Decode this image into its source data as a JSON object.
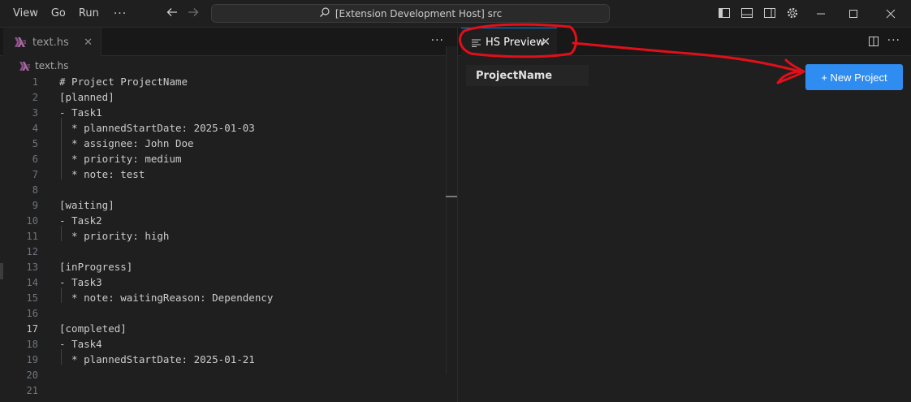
{
  "menu": {
    "items": [
      "View",
      "Go",
      "Run"
    ],
    "more": "···"
  },
  "command_center": {
    "text": "[Extension Development Host] src"
  },
  "left_editor": {
    "tab": {
      "label": "text.hs",
      "close": "✕"
    },
    "more": "···",
    "breadcrumb": "text.hs",
    "active_line": 17,
    "lines": [
      {
        "n": "1",
        "text": "# Project ProjectName",
        "guide": false
      },
      {
        "n": "2",
        "text": "[planned]",
        "guide": false
      },
      {
        "n": "3",
        "text": "- Task1",
        "guide": false
      },
      {
        "n": "4",
        "text": "  * plannedStartDate: 2025-01-03",
        "guide": true
      },
      {
        "n": "5",
        "text": "  * assignee: John Doe",
        "guide": true
      },
      {
        "n": "6",
        "text": "  * priority: medium",
        "guide": true
      },
      {
        "n": "7",
        "text": "  * note: test",
        "guide": true
      },
      {
        "n": "8",
        "text": "",
        "guide": false
      },
      {
        "n": "9",
        "text": "[waiting]",
        "guide": false
      },
      {
        "n": "10",
        "text": "- Task2",
        "guide": false
      },
      {
        "n": "11",
        "text": "  * priority: high",
        "guide": true
      },
      {
        "n": "12",
        "text": "",
        "guide": false
      },
      {
        "n": "13",
        "text": "[inProgress]",
        "guide": false
      },
      {
        "n": "14",
        "text": "- Task3",
        "guide": false
      },
      {
        "n": "15",
        "text": "  * note: waitingReason: Dependency",
        "guide": true
      },
      {
        "n": "16",
        "text": "",
        "guide": false
      },
      {
        "n": "17",
        "text": "[completed]",
        "guide": false
      },
      {
        "n": "18",
        "text": "- Task4",
        "guide": false
      },
      {
        "n": "19",
        "text": "  * plannedStartDate: 2025-01-21",
        "guide": true
      },
      {
        "n": "20",
        "text": "",
        "guide": false
      },
      {
        "n": "21",
        "text": "",
        "guide": false
      }
    ]
  },
  "right_editor": {
    "tab": {
      "label": "HS Preview",
      "close": "✕"
    },
    "more": "···",
    "project_name": "ProjectName",
    "new_project_label": "+ New Project"
  },
  "icons": {
    "back": "arrow-left-icon",
    "forward": "arrow-right-icon",
    "search": "search-icon",
    "haskell": "haskell-file-icon",
    "preview": "preview-icon",
    "split": "split-editor-icon"
  },
  "colors": {
    "accent": "#2f8cf0",
    "annotation": "#e0101a",
    "background": "#1f1f1f"
  }
}
